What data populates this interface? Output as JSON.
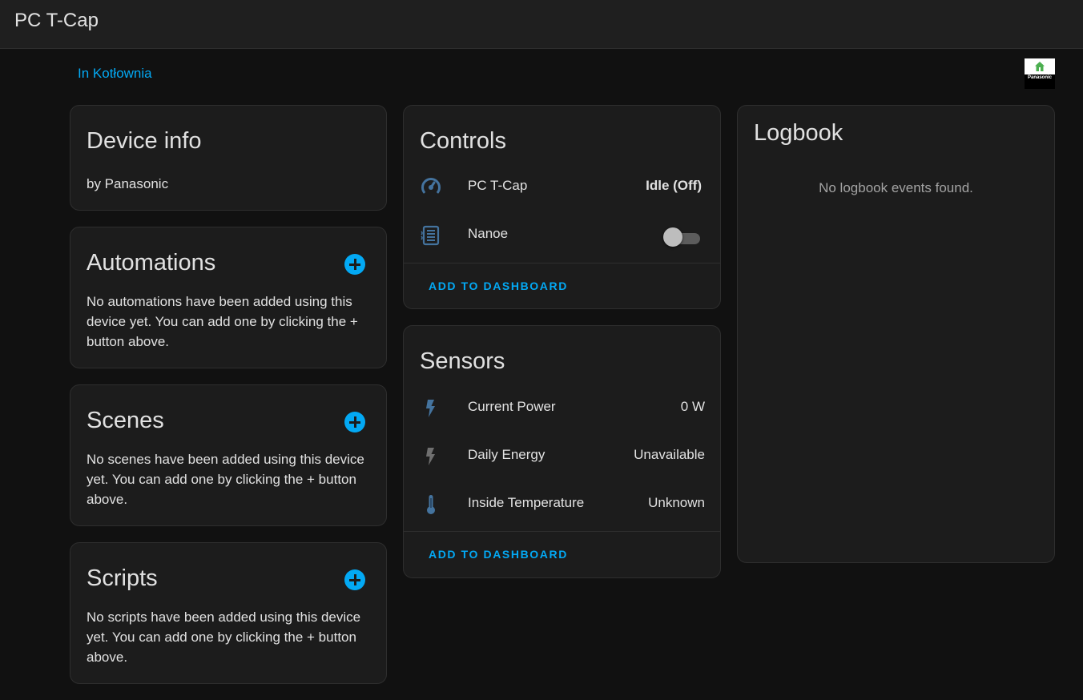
{
  "header": {
    "title": "PC T-Cap"
  },
  "area": {
    "link": "In Kotłownia"
  },
  "brand": {
    "logo_text": "Panasonic",
    "icon": "house-icon"
  },
  "device_info": {
    "title": "Device info",
    "manufacturer": "by Panasonic"
  },
  "automations": {
    "title": "Automations",
    "empty_text": "No automations have been added using this device yet. You can add one by clicking the + button above."
  },
  "scenes": {
    "title": "Scenes",
    "empty_text": "No scenes have been added using this device yet. You can add one by clicking the + button above."
  },
  "scripts": {
    "title": "Scripts",
    "empty_text": "No scripts have been added using this device yet. You can add one by clicking the + button above."
  },
  "controls": {
    "title": "Controls",
    "items": [
      {
        "icon": "climate-gauge-icon",
        "name": "PC T-Cap",
        "state": "Idle (Off)"
      },
      {
        "icon": "air-filter-icon",
        "name": "Nanoe",
        "state": "off"
      }
    ],
    "add_label": "ADD TO DASHBOARD"
  },
  "sensors": {
    "title": "Sensors",
    "items": [
      {
        "icon": "lightning-icon",
        "name": "Current Power",
        "state": "0 W"
      },
      {
        "icon": "lightning-icon",
        "name": "Daily Energy",
        "state": "Unavailable"
      },
      {
        "icon": "thermometer-icon",
        "name": "Inside Temperature",
        "state": "Unknown"
      }
    ],
    "add_label": "ADD TO DASHBOARD"
  },
  "logbook": {
    "title": "Logbook",
    "empty_text": "No logbook events found."
  },
  "colors": {
    "accent": "#03a9f4",
    "icon_blue": "#44739e",
    "background": "#111111",
    "card": "#1c1c1c"
  }
}
